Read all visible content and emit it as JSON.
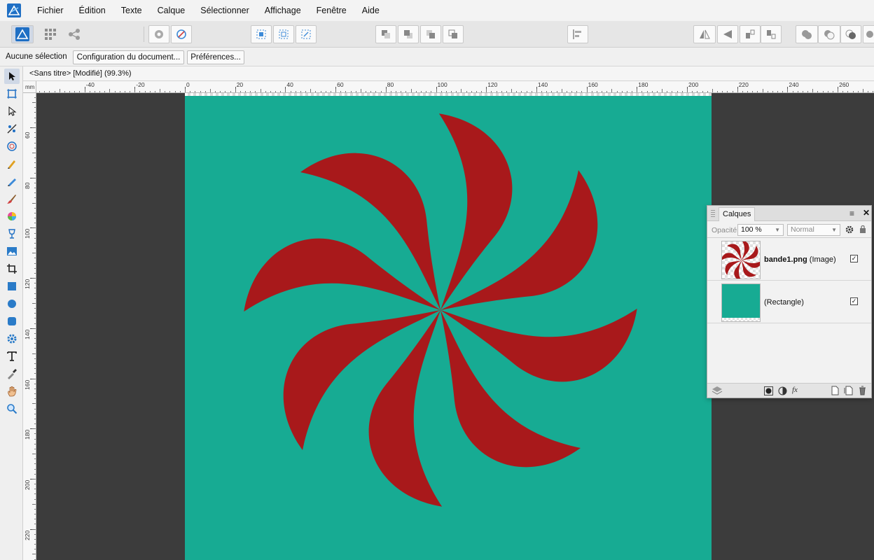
{
  "menubar": {
    "logo_icon": "affinity-designer-logo-icon",
    "items": [
      "Fichier",
      "Édition",
      "Texte",
      "Calque",
      "Sélectionner",
      "Affichage",
      "Fenêtre",
      "Aide"
    ]
  },
  "contextbar": {
    "selection_label": "Aucune sélection",
    "document_setup_label": "Configuration du document...",
    "preferences_label": "Préférences..."
  },
  "document": {
    "tab_title": "<Sans titre> [Modifié] (99.3%)"
  },
  "rulers": {
    "unit": "mm",
    "horizontal_labels": [
      "-40",
      "-20",
      "0",
      "20",
      "40",
      "60",
      "80",
      "100",
      "120",
      "140",
      "160",
      "180",
      "200",
      "220",
      "240",
      "260"
    ],
    "vertical_labels": [
      "60",
      "80",
      "100",
      "120",
      "140",
      "160",
      "180",
      "200",
      "220"
    ]
  },
  "canvas": {
    "background_color": "#3c3c3c",
    "artboard_color": "#17ab93",
    "swirl_color": "#a8191b",
    "swirl_blade_count": 8
  },
  "layers_panel": {
    "tab_title": "Calques",
    "opacity_label": "Opacité:",
    "opacity_value": "100 %",
    "blend_mode": "Normal",
    "layers": [
      {
        "name": "bande1.png",
        "type": " (Image)",
        "visible": true
      },
      {
        "name": "",
        "type": "(Rectangle)",
        "visible": true
      }
    ]
  },
  "colors": {
    "toolbar_bg": "#e6e6e6",
    "accent_blue": "#1f6fc4"
  }
}
